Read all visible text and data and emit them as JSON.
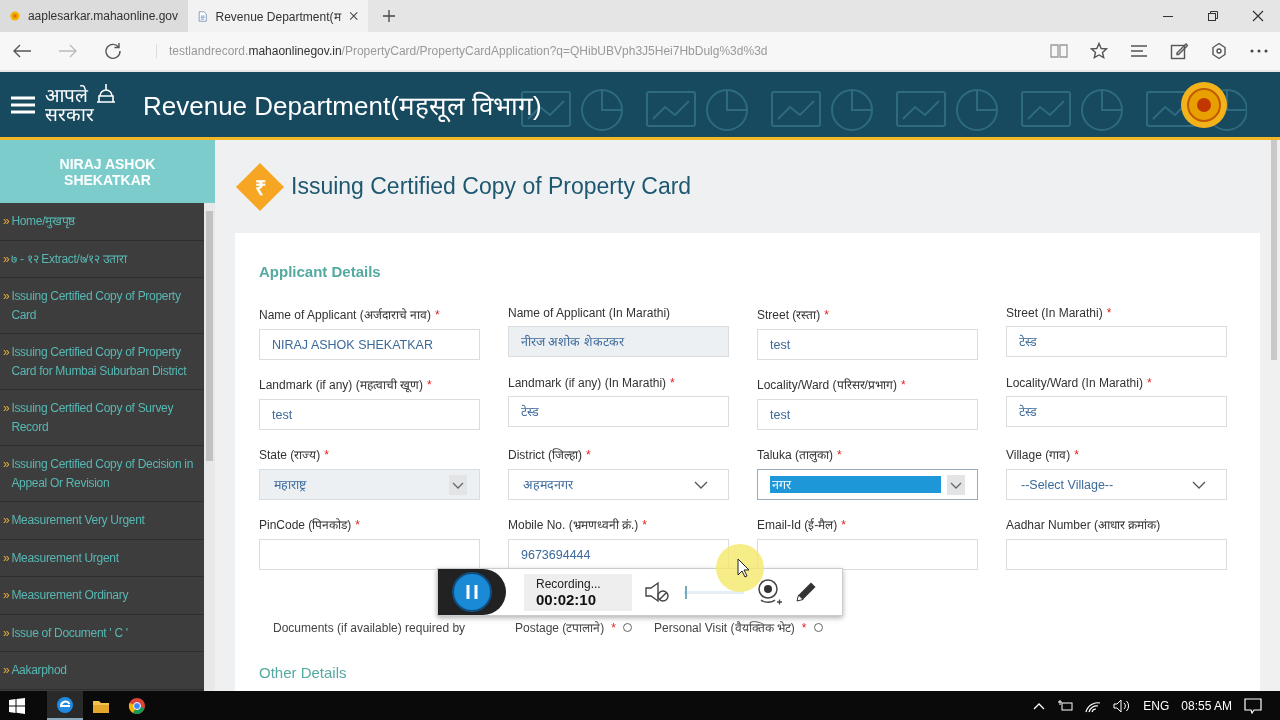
{
  "browser": {
    "tabs": [
      {
        "title": "aaplesarkar.mahaonline.gov",
        "selected": false,
        "kind": "site"
      },
      {
        "title": "Revenue Department(म",
        "selected": true,
        "kind": "page"
      }
    ],
    "url": {
      "prefix": "testlandrecord.",
      "host": "mahaonlinegov.in",
      "path": "/PropertyCard/PropertyCardApplication?q=QHibUBVph3J5Hei7HbDulg%3d%3d"
    }
  },
  "header": {
    "logo_lines": [
      "आपले",
      "सरकार"
    ],
    "title": "Revenue Department(महसूल विभाग)"
  },
  "sidebar": {
    "user_name": "NIRAJ ASHOK SHEKATKAR",
    "bullet": "»",
    "items": [
      {
        "label": "Home/मुखपृष्ठ"
      },
      {
        "label": "७ - १२ Extract/७/१२ उतारा"
      },
      {
        "label": "Issuing Certified Copy of Property Card"
      },
      {
        "label": "Issuing Certified Copy of Property Card for Mumbai Suburban District"
      },
      {
        "label": "Issuing Certified Copy of Survey Record"
      },
      {
        "label": "Issuing Certified Copy of Decision in Appeal Or Revision"
      },
      {
        "label": "Measurement Very Urgent"
      },
      {
        "label": "Measurement Urgent"
      },
      {
        "label": "Measurement Ordinary"
      },
      {
        "label": "Issue of Document ' C '"
      },
      {
        "label": "Aakarphod"
      }
    ]
  },
  "page": {
    "title_icon": "₹",
    "required_mark": "*",
    "title": "Issuing Certified Copy of Property Card",
    "section": "Applicant Details",
    "fields": [
      {
        "kind": "text",
        "label": "Name of Applicant (अर्जदाराचे नाव)",
        "required": true,
        "value": "NIRAJ ASHOK SHEKATKAR",
        "disabled": false
      },
      {
        "kind": "text",
        "label": "Name of Applicant (In Marathi)",
        "required": false,
        "value": "नीरज अशोक शेकटकर",
        "disabled": true
      },
      {
        "kind": "text",
        "label": "Street (रस्ता)",
        "required": true,
        "value": "test",
        "disabled": false
      },
      {
        "kind": "text",
        "label": "Street (In Marathi)",
        "required": true,
        "value": "टेस्ड",
        "disabled": false
      },
      {
        "kind": "text",
        "label": "Landmark (if any) (महत्वाची खूण)",
        "required": true,
        "value": "test",
        "disabled": false
      },
      {
        "kind": "text",
        "label": "Landmark (if any) (In Marathi)",
        "required": true,
        "value": "टेस्ड",
        "disabled": false
      },
      {
        "kind": "text",
        "label": "Locality/Ward (परिसर/प्रभाग)",
        "required": true,
        "value": "test",
        "disabled": false
      },
      {
        "kind": "text",
        "label": "Locality/Ward (In Marathi)",
        "required": true,
        "value": "टेस्ड",
        "disabled": false
      },
      {
        "kind": "select",
        "label": "State (राज्य)",
        "required": true,
        "value": "महाराष्ट्र",
        "disabled": true,
        "focused": false
      },
      {
        "kind": "select",
        "label": "District (जिल्हा)",
        "required": true,
        "value": "अहमदनगर",
        "disabled": false,
        "focused": false
      },
      {
        "kind": "select",
        "label": "Taluka (तालुका)",
        "required": true,
        "value": "नगर",
        "disabled": false,
        "focused": true
      },
      {
        "kind": "select",
        "label": "Village (गाव)",
        "required": true,
        "value": "--Select Village--",
        "disabled": false,
        "focused": false
      },
      {
        "kind": "text",
        "label": "PinCode (पिनकोड)",
        "required": true,
        "disabled": false
      },
      {
        "kind": "text",
        "label": "Mobile No. (भ्रमणध्वनी क्रं.)",
        "required": true,
        "value": "9673694444",
        "disabled": false
      },
      {
        "kind": "text",
        "label": "Email-Id (ई-मैल)",
        "required": true,
        "disabled": false
      },
      {
        "kind": "text",
        "label": "Aadhar Number (आधार क्रमांक)",
        "required": false,
        "disabled": false
      }
    ],
    "documents": {
      "label": "Documents (if available) required by",
      "options": [
        {
          "label": "Postage (टपालाने)",
          "required": true,
          "selected": false
        },
        {
          "label": "Personal Visit (वैयक्तिक भेट)",
          "required": true,
          "selected": false
        }
      ]
    },
    "section_2": "Other Details"
  },
  "recorder": {
    "status": "Recording...",
    "time": "00:02:10",
    "level": 0.02
  },
  "taskbar": {
    "language": "ENG",
    "time": "08:55 AM"
  }
}
